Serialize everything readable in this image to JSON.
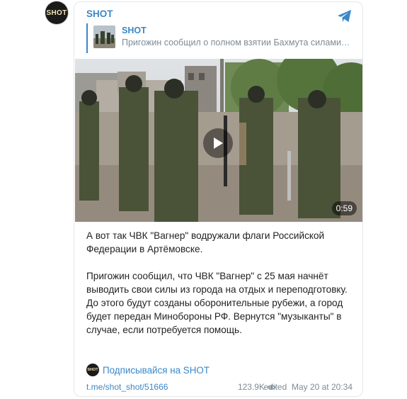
{
  "channel": {
    "avatar_text": "SHOT",
    "name": "SHOT"
  },
  "reply": {
    "author": "SHOT",
    "text": "Пригожин сообщил о полном взятии Бахмута силами…"
  },
  "video": {
    "duration": "0:59"
  },
  "post": {
    "paragraph_1": "А вот так ЧВК \"Вагнер\" водружали флаги Российской Федерации в Артёмовске.",
    "paragraph_2": "Пригожин сообщил, что ЧВК \"Вагнер\" с 25 мая начнёт выводить свои силы из города на отдых и переподготовку. До этого будут созданы оборонительные рубежи, а город будет передан Минобороны РФ. Вернутся \"музыканты\" в случае, если потребуется помощь."
  },
  "subscribe": {
    "label": "Подписывайся на SHOT"
  },
  "footer": {
    "link": "t.me/shot_shot/51666",
    "views": "123.9K",
    "edited": "edited  May 20 at 20:34"
  },
  "colors": {
    "accent": "#3a88c8",
    "muted": "#7d8b96",
    "text": "#222222"
  }
}
